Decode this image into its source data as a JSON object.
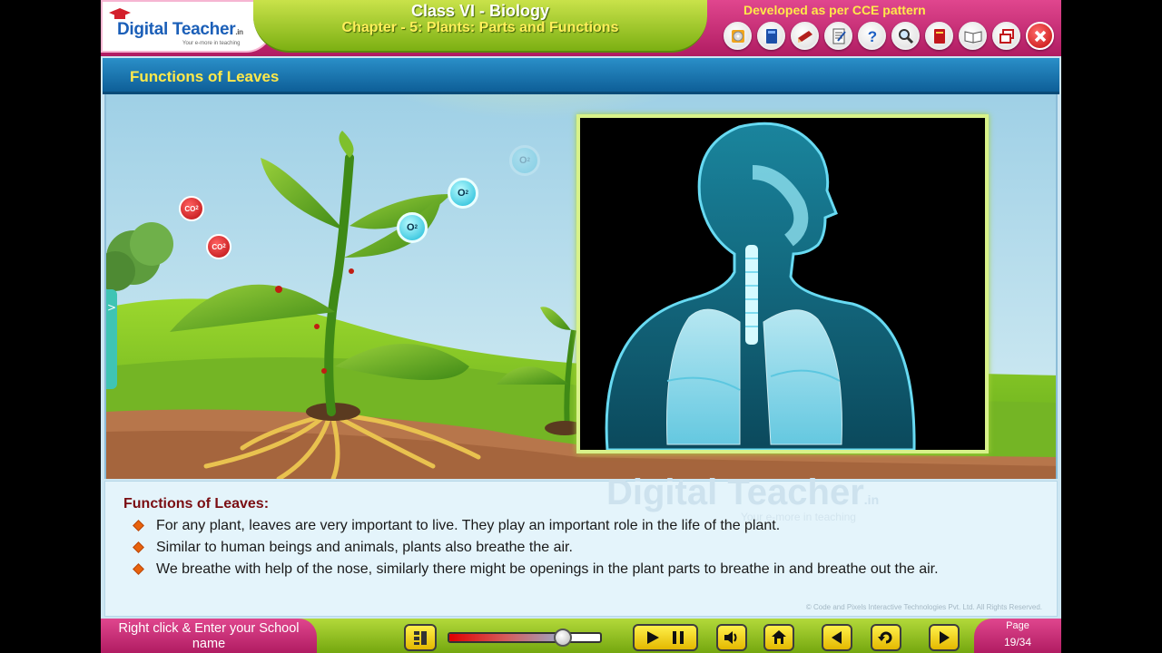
{
  "header": {
    "logo_name": "Digital Teacher",
    "logo_suffix": ".in",
    "logo_tagline": "Your e-more in teaching",
    "title": "Class VI - Biology",
    "chapter": "Chapter - 5: Plants: Parts and Functions",
    "cce_note": "Developed as per CCE pattern"
  },
  "toolbar": {
    "icons": [
      "cd-icon",
      "book-icon",
      "pencil-case-icon",
      "notepad-icon",
      "help-icon",
      "search-icon",
      "dictionary-icon",
      "open-book-icon",
      "window-restore-icon",
      "close-icon"
    ]
  },
  "section": {
    "title": "Functions of Leaves"
  },
  "scene": {
    "side_tab": ">",
    "molecules": {
      "co2_a": "CO",
      "co2_b": "CO",
      "o2_a": "O",
      "o2_b": "O",
      "o2_faded": "O",
      "subscript": "2"
    }
  },
  "content": {
    "heading": "Functions of Leaves:",
    "bullets": [
      "For any plant, leaves are very important to live. They play an important role in the life of the plant.",
      "Similar to human beings and animals, plants also breathe the air.",
      "We breathe with help of the nose, similarly there might be openings in the plant parts to breathe in and breathe out the air."
    ],
    "watermark": "Digital Teacher",
    "watermark_suffix": ".in",
    "watermark_tagline": "Your e-more in teaching",
    "copyright": "© Code and Pixels Interactive Technologies  Pvt. Ltd. All Rights Reserved."
  },
  "footer": {
    "school_text": "Right click & Enter your School name",
    "page_label": "Page",
    "page_value": "19/34",
    "progress_fraction": 0.75,
    "colors": {
      "accent_pink": "#c92574",
      "accent_green": "#8cc21f",
      "button_yellow": "#f5d20a"
    }
  }
}
